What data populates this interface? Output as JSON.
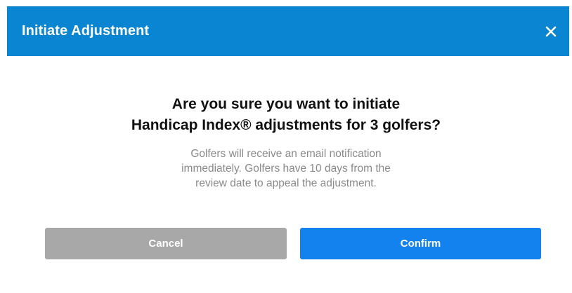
{
  "dialog": {
    "title": "Initiate Adjustment",
    "close_icon": "close-icon",
    "question_line1": "Are you sure you want to initiate",
    "question_line2": "Handicap Index® adjustments for 3 golfers?",
    "note_line1": "Golfers will receive an email notification",
    "note_line2": "immediately. Golfers have 10 days from the",
    "note_line3": "review date to appeal the adjustment.",
    "cancel_label": "Cancel",
    "confirm_label": "Confirm"
  },
  "colors": {
    "header": "#0a85d1",
    "cancel": "#a8a8a8",
    "confirm": "#1381ee",
    "note_text": "#8a8a8a"
  }
}
